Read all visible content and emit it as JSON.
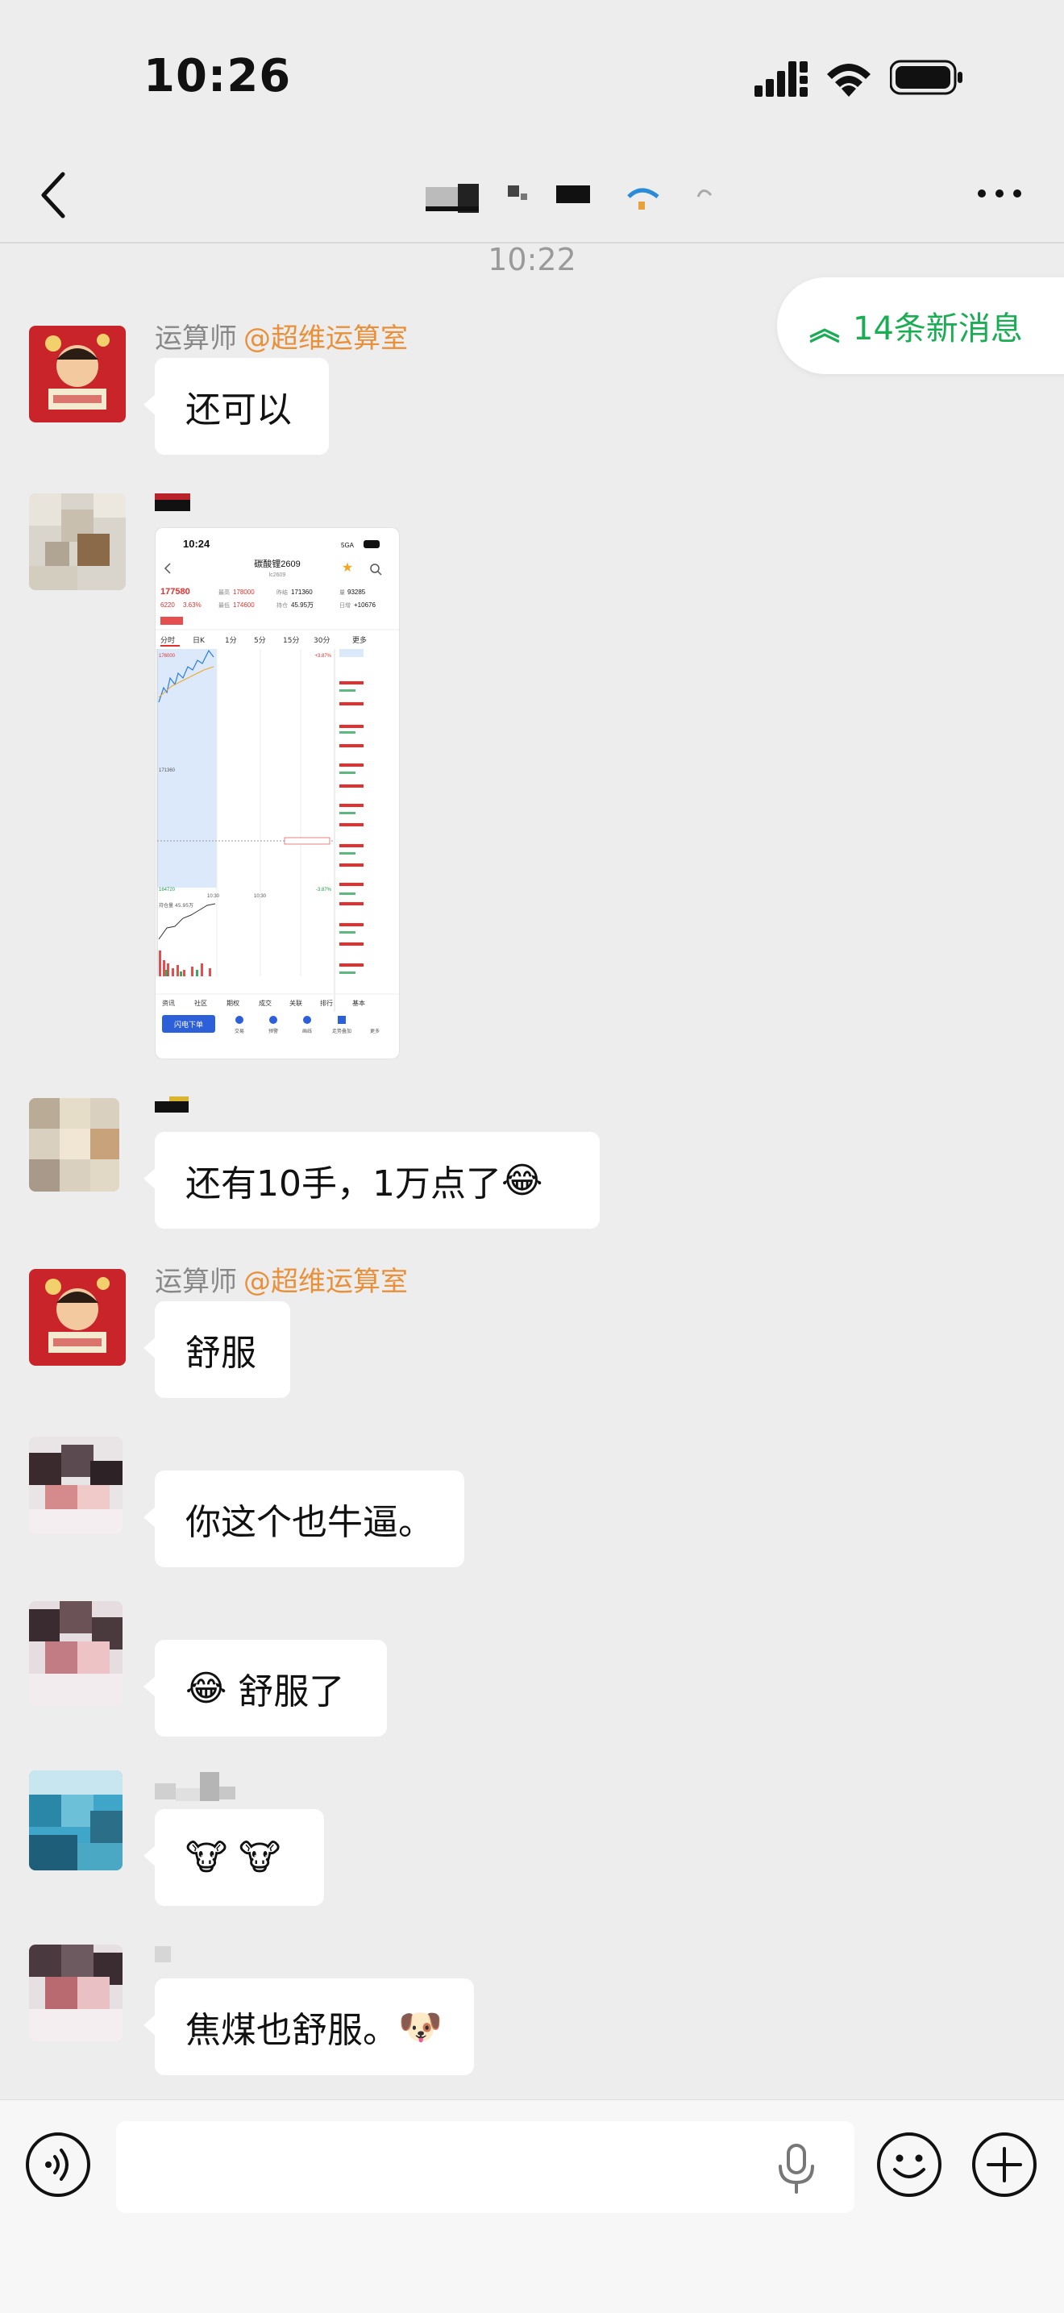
{
  "status_bar": {
    "time": "10:26"
  },
  "header": {
    "title": ""
  },
  "chat": {
    "timestamp": "10:22",
    "new_messages_label": "14条新消息",
    "messages": [
      {
        "sender": "运算师",
        "mention": "@超维运算室",
        "text": "还可以"
      },
      {
        "sender": "",
        "type": "image"
      },
      {
        "sender": "",
        "text": "还有10手，1万点了",
        "emoji": "😂"
      },
      {
        "sender": "运算师",
        "mention": "@超维运算室",
        "text": "舒服"
      },
      {
        "sender": "",
        "text": "你这个也牛逼。"
      },
      {
        "sender": "",
        "emoji": "😂",
        "text": "舒服了"
      },
      {
        "sender": "",
        "text": "🐮 🐮"
      },
      {
        "sender": "",
        "text": "焦煤也舒服。",
        "emoji": "🐶"
      }
    ]
  },
  "shared_screenshot": {
    "time": "10:24",
    "network": "5GA",
    "contract": "碳酸锂2609",
    "code": "lc2609",
    "last_price": "177580",
    "change": "6220",
    "change_pct": "3.63%",
    "high_label": "最高",
    "high": "178000",
    "low_label": "最低",
    "low": "174600",
    "settle_label": "昨结",
    "settle": "171360",
    "open_interest_label": "持仓",
    "open_interest": "45.95万",
    "volume_label": "量",
    "volume": "93285",
    "daily_add_label": "日增",
    "daily_add": "+10676",
    "tabs": [
      "分时",
      "日K",
      "1分",
      "5分",
      "15分",
      "30分",
      "更多"
    ],
    "axis_top": "178000",
    "axis_mid": "171360",
    "axis_bottom": "164720",
    "axis_top_pct": "+3.87%",
    "axis_bottom_pct": "-3.87%",
    "time_start": "10:30",
    "time_end": "10:30",
    "sub_label": "持仓量 45.95万",
    "bottom_tabs": [
      "资讯",
      "社区",
      "期权",
      "成交",
      "关联",
      "排行",
      "基本"
    ],
    "action_button": "闪电下单",
    "action_icons": [
      "交易",
      "预警",
      "画线",
      "走势叠加",
      "更多"
    ]
  },
  "input_bar": {
    "placeholder": ""
  }
}
